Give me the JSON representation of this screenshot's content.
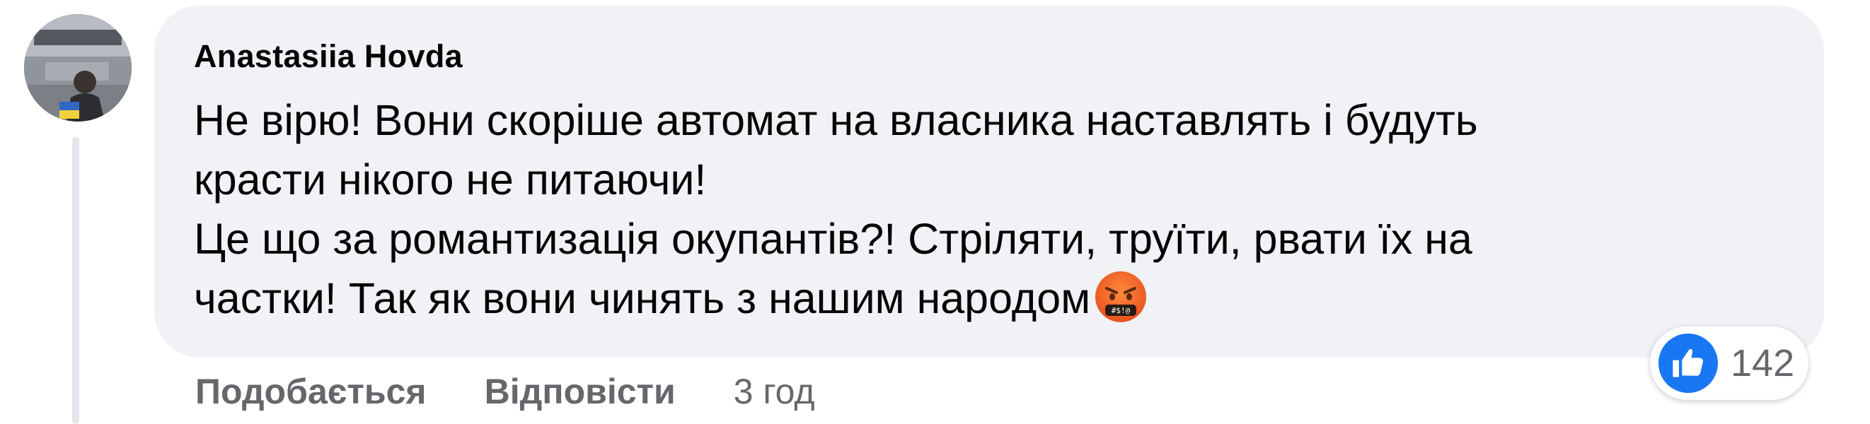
{
  "comment": {
    "author": "Anastasiia Hovda",
    "text": "Не вірю! Вони скоріше автомат на власника наставлять і будуть\nкрасти нікого не питаючи!\nЦе що за романтизація окупантів?! Стріляти, труїти, рвати їх на\nчастки! Так як вони чинять з нашим народом",
    "emoji": "angry-face-with-symbols-icon"
  },
  "actions": {
    "like_label": "Подобається",
    "reply_label": "Відповісти",
    "timestamp": "3 год"
  },
  "reactions": {
    "icon": "thumbs-up-icon",
    "count": "142"
  },
  "colors": {
    "bubble": "#f0f2f5",
    "text": "#050505",
    "secondary": "#65676b",
    "accent": "#1877f2"
  }
}
